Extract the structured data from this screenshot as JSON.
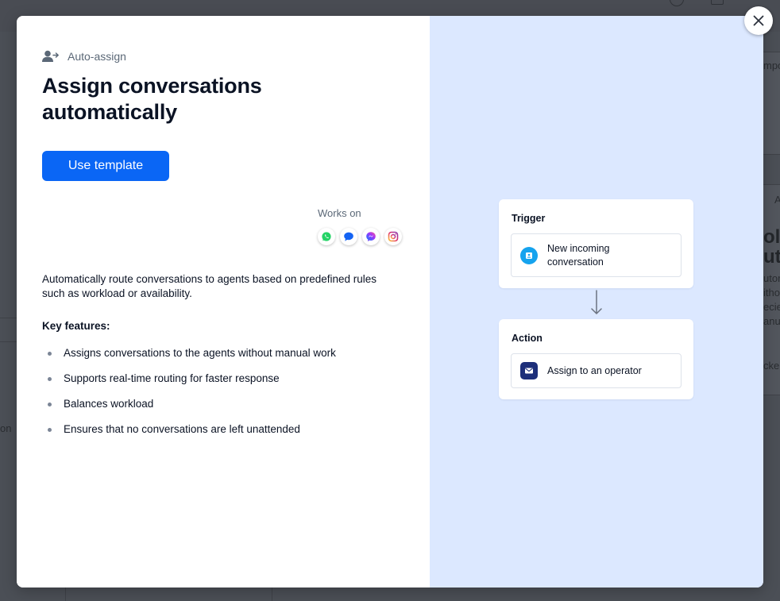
{
  "modal": {
    "category_label": "Auto-assign",
    "title": "Assign conversations automatically",
    "use_template_label": "Use template",
    "works_on_label": "Works on",
    "channels": [
      {
        "icon": "whatsapp-icon",
        "color": "#25d366"
      },
      {
        "icon": "chat-bubble-icon",
        "color": "#1463f3"
      },
      {
        "icon": "messenger-icon",
        "color": "#8b5cf6"
      },
      {
        "icon": "instagram-icon",
        "color": "#e1306c"
      }
    ],
    "description": "Automatically route conversations to agents based on predefined rules such as workload or availability.",
    "features_heading": "Key features:",
    "features": [
      "Assigns conversations to the agents without manual work",
      "Supports real-time routing for faster response",
      "Balances workload",
      "Ensures that no conversations are left unattended"
    ],
    "flow": {
      "trigger_heading": "Trigger",
      "trigger_step": "New incoming conversation",
      "action_heading": "Action",
      "action_step": "Assign to an operator"
    },
    "close_icon": "close-icon"
  },
  "background": {
    "fragments": [
      "mpo",
      "olv",
      "uto",
      "utor",
      "itho",
      "ecie",
      "anu",
      "cke",
      "on",
      "A"
    ]
  },
  "colors": {
    "primary": "#0a66f5",
    "illustration_bg": "#dce8ff",
    "heading": "#0b1324",
    "muted": "#5b6877"
  }
}
